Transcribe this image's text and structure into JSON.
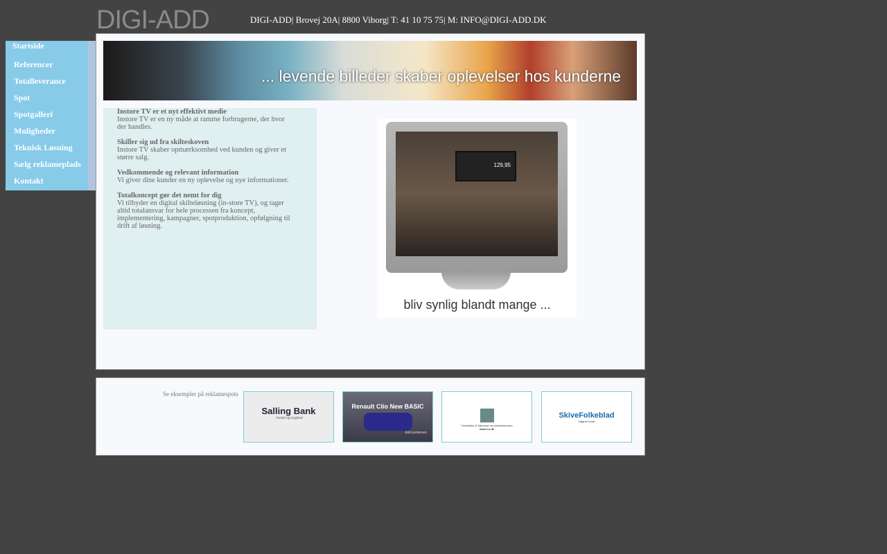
{
  "header": {
    "logo": "DIGI-ADD",
    "contact": "DIGI-ADD| Brovej 20A| 8800 Viborg| T: 41 10 75 75| M: INFO@DIGI-ADD.DK"
  },
  "nav": [
    {
      "label": "Startside"
    },
    {
      "label": "Referencer"
    },
    {
      "label": "Totalleverance"
    },
    {
      "label": "Spot"
    },
    {
      "label": "Spotgalleri"
    },
    {
      "label": "Muligheder"
    },
    {
      "label": "Teknisk Løsning"
    },
    {
      "label": "Sælg reklameplads"
    },
    {
      "label": "Kontakt"
    }
  ],
  "banner": {
    "text": "... levende billeder skaber oplevelser hos kunderne"
  },
  "sections": [
    {
      "title": "Instore TV er et nyt effektivt medie",
      "body": "Instore TV er en ny måde at ramme forbrugerne, der hvor der handles."
    },
    {
      "title": "Skiller sig ud fra skilteskoven",
      "body": "Instore TV skaber opmærksomhed ved kunden og giver et større salg."
    },
    {
      "title": "Vedkommende og relevant information",
      "body": "Vi giver dine kunder en ny oplevelse og nye informationer."
    },
    {
      "title": "Totalkoncept gør det nemt for dig",
      "body": "Vi tilbyder en digital skilteløsning (in-store TV), og tager altid totalansvar for hele processen fra koncept, implementering, kampagner, spotproduktion, opfølgning til drift af løsning."
    }
  ],
  "tv": {
    "price": "129,95",
    "caption": "bliv synlig blandt mange ..."
  },
  "footer": {
    "label": "Se eksempler på reklamespots",
    "thumbs": [
      {
        "title": "Salling Bank",
        "sub": "- fordel og tryghed"
      },
      {
        "title": "Renault Clio New BASIC",
        "sub": "dahl pedersen"
      },
      {
        "title": "Frederikke & Sørensen as reklamebureau",
        "sub": "www.f-s.dk"
      },
      {
        "title": "SkiveFolkeblad",
        "sub": "Døgnet rundt"
      }
    ]
  }
}
